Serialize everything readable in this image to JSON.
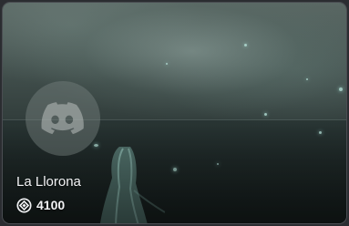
{
  "card": {
    "title": "La Llorona",
    "price": "4100",
    "price_icon": "orb-icon",
    "placeholder_logo": "discord-logo-icon"
  }
}
